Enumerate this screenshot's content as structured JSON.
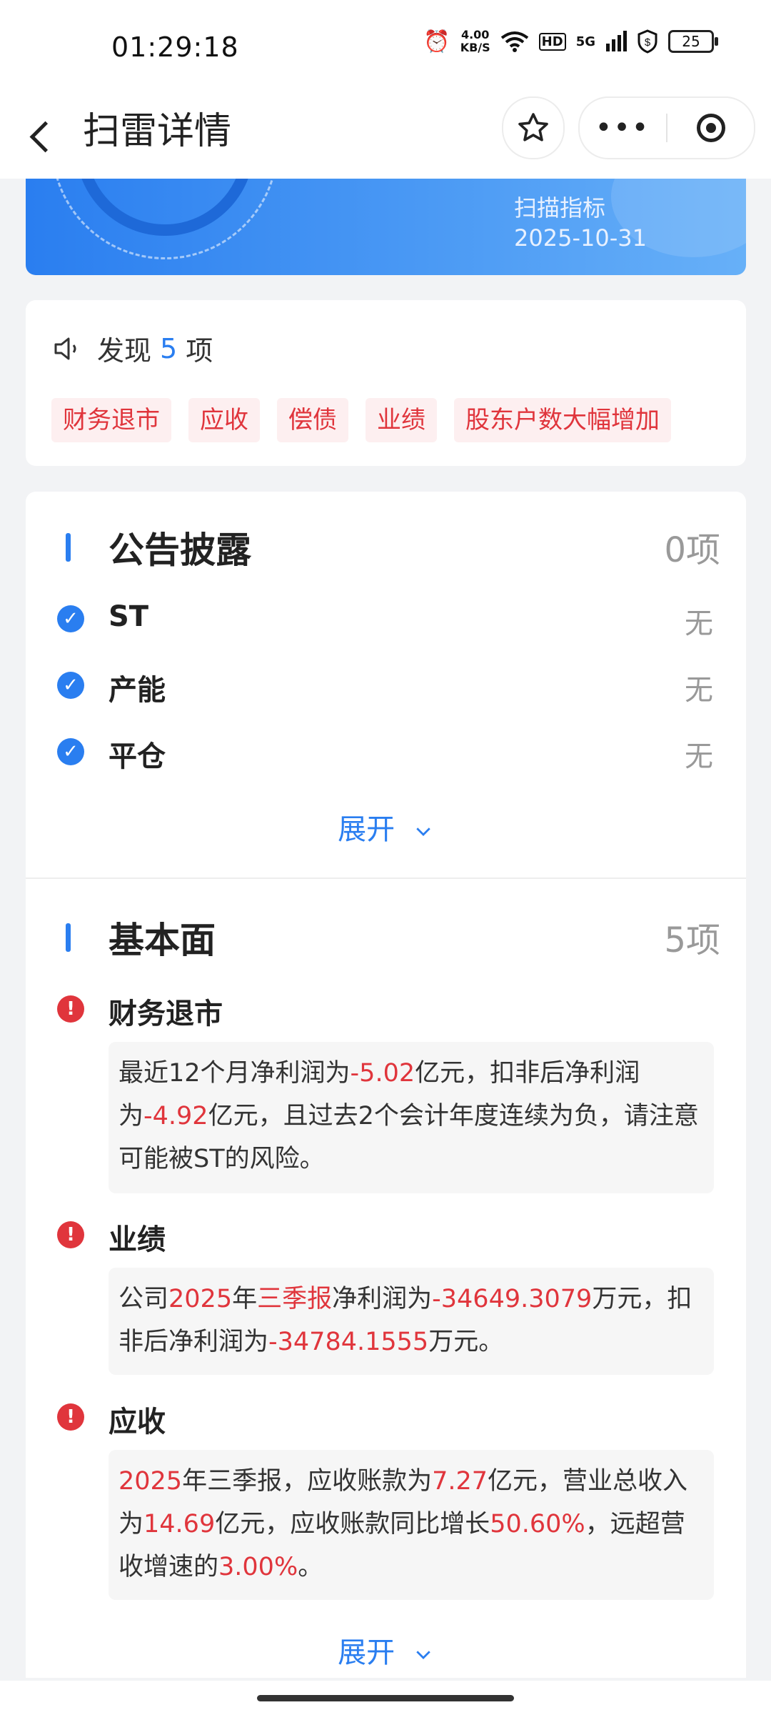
{
  "status_bar": {
    "time": "01:29:18",
    "net_speed_value": "4.00",
    "net_speed_unit": "KB/S",
    "network": "5G",
    "hd": "HD",
    "battery": "25",
    "icons": [
      "alarm-icon",
      "wifi-icon",
      "signal-icon",
      "vpn-icon"
    ]
  },
  "header": {
    "title": "扫雷详情",
    "back_icon": "chevron-left-icon",
    "star_icon": "star-icon",
    "more_label": "•••",
    "close_icon": "target-icon"
  },
  "banner": {
    "label": "扫描指标",
    "date": "2025-10-31"
  },
  "found": {
    "prefix": "发现",
    "count": "5",
    "suffix": "项",
    "icon": "speaker-icon",
    "tags": [
      "财务退市",
      "应收",
      "偿债",
      "业绩",
      "股东户数大幅增加"
    ]
  },
  "announcements": {
    "title": "公告披露",
    "count": "0项",
    "items": [
      {
        "label": "ST",
        "value": "无"
      },
      {
        "label": "产能",
        "value": "无"
      },
      {
        "label": "平仓",
        "value": "无"
      }
    ],
    "expand": "展开"
  },
  "fundamentals": {
    "title": "基本面",
    "count": "5项",
    "items": [
      {
        "label": "财务退市",
        "desc": [
          {
            "t": "最近12个月净利润为",
            "hl": false
          },
          {
            "t": "-5.02",
            "hl": true
          },
          {
            "t": "亿元，扣非后净利润为",
            "hl": false
          },
          {
            "t": "-4.92",
            "hl": true
          },
          {
            "t": "亿元，且过去2个会计年度连续为负，请注意可能被ST的风险。",
            "hl": false
          }
        ]
      },
      {
        "label": "业绩",
        "desc": [
          {
            "t": "公司",
            "hl": false
          },
          {
            "t": "2025",
            "hl": true
          },
          {
            "t": "年",
            "hl": false
          },
          {
            "t": "三季报",
            "hl": true
          },
          {
            "t": "净利润为",
            "hl": false
          },
          {
            "t": "-34649.3079",
            "hl": true
          },
          {
            "t": "万元，扣非后净利润为",
            "hl": false
          },
          {
            "t": "-34784.1555",
            "hl": true
          },
          {
            "t": "万元。",
            "hl": false
          }
        ]
      },
      {
        "label": "应收",
        "desc": [
          {
            "t": "2025",
            "hl": true
          },
          {
            "t": "年三季报，应收账款为",
            "hl": false
          },
          {
            "t": "7.27",
            "hl": true
          },
          {
            "t": "亿元，营业总收入为",
            "hl": false
          },
          {
            "t": "14.69",
            "hl": true
          },
          {
            "t": "亿元，应收账款同比增长",
            "hl": false
          },
          {
            "t": "50.60%",
            "hl": true
          },
          {
            "t": "，远超营收增速的",
            "hl": false
          },
          {
            "t": "3.00%",
            "hl": true
          },
          {
            "t": "。",
            "hl": false
          }
        ]
      }
    ],
    "expand": "展开"
  },
  "colors": {
    "accent": "#2a7ef0",
    "danger": "#e0353c",
    "tag_bg": "#fdeff0"
  }
}
